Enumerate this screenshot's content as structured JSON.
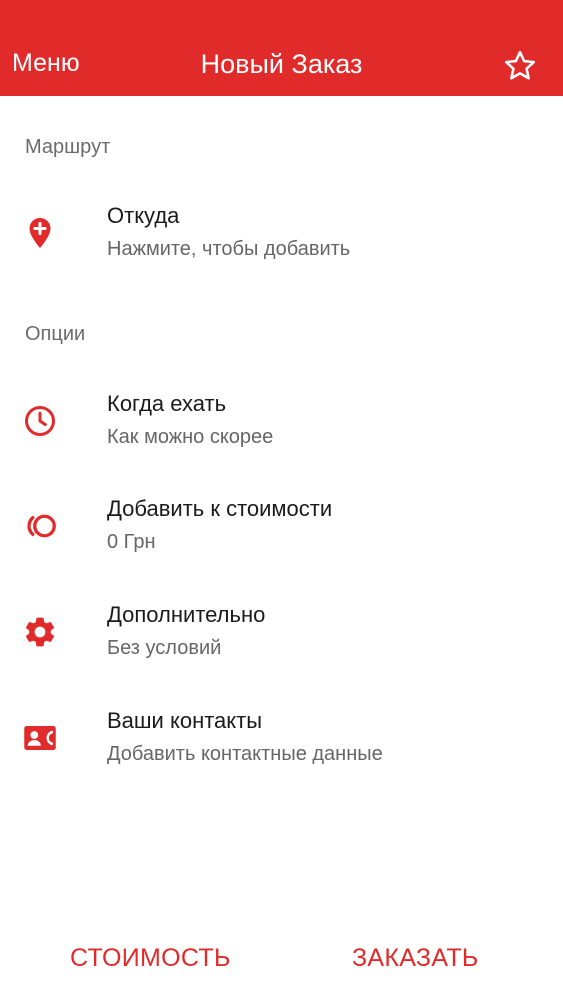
{
  "header": {
    "menu_label": "Меню",
    "title": "Новый Заказ",
    "favorite_icon": "star-outline-icon"
  },
  "route": {
    "section_label": "Маршрут",
    "from": {
      "title": "Откуда",
      "subtitle": "Нажмите, чтобы добавить",
      "icon": "add-location-pin-icon"
    }
  },
  "options": {
    "section_label": "Опции",
    "items": [
      {
        "title": "Когда ехать",
        "subtitle": "Как можно скорее",
        "icon": "clock-icon"
      },
      {
        "title": "Добавить к стоимости",
        "subtitle": "0 Грн",
        "icon": "coins-icon"
      },
      {
        "title": "Дополнительно",
        "subtitle": "Без условий",
        "icon": "gear-icon"
      },
      {
        "title": "Ваши контакты",
        "subtitle": "Добавить контактные данные",
        "icon": "contact-card-icon"
      }
    ]
  },
  "footer": {
    "cost_label": "СТОИМОСТЬ",
    "order_label": "ЗАКАЗАТЬ"
  },
  "colors": {
    "accent": "#e12b2b",
    "primary_text": "#1a1a1a",
    "secondary_text": "#666666",
    "background": "#ffffff"
  }
}
